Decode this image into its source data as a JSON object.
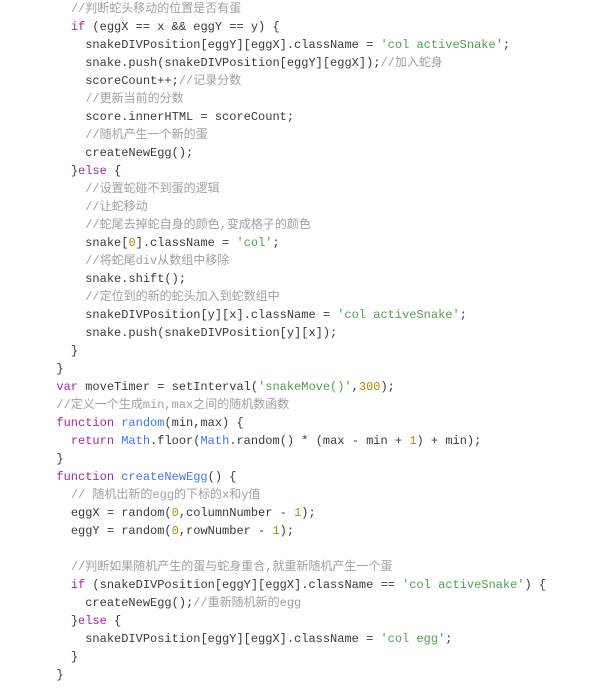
{
  "language": "javascript",
  "code_lines": [
    {
      "indent": 2,
      "tokens": [
        {
          "t": "cm",
          "v": "//判断蛇头移动的位置是否有蛋"
        }
      ]
    },
    {
      "indent": 2,
      "tokens": [
        {
          "t": "kw",
          "v": "if"
        },
        {
          "t": "id",
          "v": " (eggX == x && eggY == y) {"
        }
      ]
    },
    {
      "indent": 3,
      "tokens": [
        {
          "t": "id",
          "v": "snakeDIVPosition[eggY][eggX].className = "
        },
        {
          "t": "str",
          "v": "'col activeSnake'"
        },
        {
          "t": "id",
          "v": ";"
        }
      ]
    },
    {
      "indent": 3,
      "tokens": [
        {
          "t": "id",
          "v": "snake.push(snakeDIVPosition[eggY][eggX]);"
        },
        {
          "t": "cm",
          "v": "//加入蛇身"
        }
      ]
    },
    {
      "indent": 3,
      "tokens": [
        {
          "t": "id",
          "v": "scoreCount++;"
        },
        {
          "t": "cm",
          "v": "//记录分数"
        }
      ]
    },
    {
      "indent": 3,
      "tokens": [
        {
          "t": "cm",
          "v": "//更新当前的分数"
        }
      ]
    },
    {
      "indent": 3,
      "tokens": [
        {
          "t": "id",
          "v": "score.innerHTML = scoreCount;"
        }
      ]
    },
    {
      "indent": 3,
      "tokens": [
        {
          "t": "cm",
          "v": "//随机产生一个新的蛋"
        }
      ]
    },
    {
      "indent": 3,
      "tokens": [
        {
          "t": "id",
          "v": "createNewEgg();"
        }
      ]
    },
    {
      "indent": 2,
      "tokens": [
        {
          "t": "id",
          "v": "}"
        },
        {
          "t": "kw",
          "v": "else"
        },
        {
          "t": "id",
          "v": " {"
        }
      ]
    },
    {
      "indent": 3,
      "tokens": [
        {
          "t": "cm",
          "v": "//设置蛇碰不到蛋的逻辑"
        }
      ]
    },
    {
      "indent": 3,
      "tokens": [
        {
          "t": "cm",
          "v": "//让蛇移动"
        }
      ]
    },
    {
      "indent": 3,
      "tokens": [
        {
          "t": "cm",
          "v": "//蛇尾去掉蛇自身的颜色,变成格子的颜色"
        }
      ]
    },
    {
      "indent": 3,
      "tokens": [
        {
          "t": "id",
          "v": "snake["
        },
        {
          "t": "num",
          "v": "0"
        },
        {
          "t": "id",
          "v": "].className = "
        },
        {
          "t": "str",
          "v": "'col'"
        },
        {
          "t": "id",
          "v": ";"
        }
      ]
    },
    {
      "indent": 3,
      "tokens": [
        {
          "t": "cm",
          "v": "//将蛇尾div从数组中移除"
        }
      ]
    },
    {
      "indent": 3,
      "tokens": [
        {
          "t": "id",
          "v": "snake.shift();"
        }
      ]
    },
    {
      "indent": 3,
      "tokens": [
        {
          "t": "cm",
          "v": "//定位到的新的蛇头加入到蛇数组中"
        }
      ]
    },
    {
      "indent": 3,
      "tokens": [
        {
          "t": "id",
          "v": "snakeDIVPosition[y][x].className = "
        },
        {
          "t": "str",
          "v": "'col activeSnake'"
        },
        {
          "t": "id",
          "v": ";"
        }
      ]
    },
    {
      "indent": 3,
      "tokens": [
        {
          "t": "id",
          "v": "snake.push(snakeDIVPosition[y][x]);"
        }
      ]
    },
    {
      "indent": 2,
      "tokens": [
        {
          "t": "id",
          "v": "}"
        }
      ]
    },
    {
      "indent": 1,
      "tokens": [
        {
          "t": "id",
          "v": "}"
        }
      ]
    },
    {
      "indent": 1,
      "tokens": [
        {
          "t": "kw",
          "v": "var"
        },
        {
          "t": "id",
          "v": " moveTimer = setInterval("
        },
        {
          "t": "str",
          "v": "'snakeMove()'"
        },
        {
          "t": "id",
          "v": ","
        },
        {
          "t": "num",
          "v": "300"
        },
        {
          "t": "id",
          "v": ");"
        }
      ]
    },
    {
      "indent": 1,
      "tokens": [
        {
          "t": "cm",
          "v": "//定义一个生成min,max之间的随机数函数"
        }
      ]
    },
    {
      "indent": 1,
      "tokens": [
        {
          "t": "kw",
          "v": "function"
        },
        {
          "t": "id",
          "v": " "
        },
        {
          "t": "fn",
          "v": "random"
        },
        {
          "t": "id",
          "v": "(min,max) {"
        }
      ]
    },
    {
      "indent": 2,
      "tokens": [
        {
          "t": "kw",
          "v": "return"
        },
        {
          "t": "id",
          "v": " "
        },
        {
          "t": "fn",
          "v": "Math"
        },
        {
          "t": "id",
          "v": ".floor("
        },
        {
          "t": "fn",
          "v": "Math"
        },
        {
          "t": "id",
          "v": ".random() * (max - min + "
        },
        {
          "t": "num",
          "v": "1"
        },
        {
          "t": "id",
          "v": ") + min);"
        }
      ]
    },
    {
      "indent": 1,
      "tokens": [
        {
          "t": "id",
          "v": "}"
        }
      ]
    },
    {
      "indent": 1,
      "tokens": [
        {
          "t": "kw",
          "v": "function"
        },
        {
          "t": "id",
          "v": " "
        },
        {
          "t": "fn",
          "v": "createNewEgg"
        },
        {
          "t": "id",
          "v": "() {"
        }
      ]
    },
    {
      "indent": 2,
      "tokens": [
        {
          "t": "cm",
          "v": "// 随机出新的egg的下标的x和y值"
        }
      ]
    },
    {
      "indent": 2,
      "tokens": [
        {
          "t": "id",
          "v": "eggX = random("
        },
        {
          "t": "num",
          "v": "0"
        },
        {
          "t": "id",
          "v": ",columnNumber - "
        },
        {
          "t": "num",
          "v": "1"
        },
        {
          "t": "id",
          "v": ");"
        }
      ]
    },
    {
      "indent": 2,
      "tokens": [
        {
          "t": "id",
          "v": "eggY = random("
        },
        {
          "t": "num",
          "v": "0"
        },
        {
          "t": "id",
          "v": ",rowNumber - "
        },
        {
          "t": "num",
          "v": "1"
        },
        {
          "t": "id",
          "v": ");"
        }
      ]
    },
    {
      "indent": 0,
      "tokens": [
        {
          "t": "id",
          "v": ""
        }
      ]
    },
    {
      "indent": 2,
      "tokens": [
        {
          "t": "cm",
          "v": "//判断如果随机产生的蛋与蛇身重合,就重新随机产生一个蛋"
        }
      ]
    },
    {
      "indent": 2,
      "tokens": [
        {
          "t": "kw",
          "v": "if"
        },
        {
          "t": "id",
          "v": " (snakeDIVPosition[eggY][eggX].className == "
        },
        {
          "t": "str",
          "v": "'col activeSnake'"
        },
        {
          "t": "id",
          "v": ") {"
        }
      ]
    },
    {
      "indent": 3,
      "tokens": [
        {
          "t": "id",
          "v": "createNewEgg();"
        },
        {
          "t": "cm",
          "v": "//重新随机新的egg"
        }
      ]
    },
    {
      "indent": 2,
      "tokens": [
        {
          "t": "id",
          "v": "}"
        },
        {
          "t": "kw",
          "v": "else"
        },
        {
          "t": "id",
          "v": " {"
        }
      ]
    },
    {
      "indent": 3,
      "tokens": [
        {
          "t": "id",
          "v": "snakeDIVPosition[eggY][eggX].className = "
        },
        {
          "t": "str",
          "v": "'col egg'"
        },
        {
          "t": "id",
          "v": ";"
        }
      ]
    },
    {
      "indent": 2,
      "tokens": [
        {
          "t": "id",
          "v": "}"
        }
      ]
    },
    {
      "indent": 1,
      "tokens": [
        {
          "t": "id",
          "v": "}"
        }
      ]
    }
  ],
  "indent_unit": "  "
}
